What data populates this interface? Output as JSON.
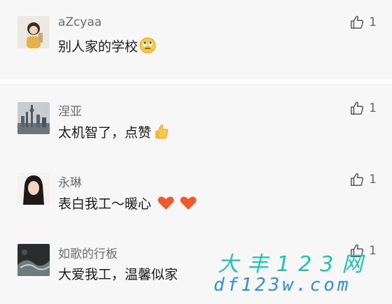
{
  "comments": [
    {
      "name": "aZcyaa",
      "text": "别人家的学校",
      "emoji": "rolling-eyes",
      "likes": "1"
    },
    {
      "name": "涅亚",
      "text": "太机智了，点赞",
      "emoji": "thumbs-up",
      "likes": "1"
    },
    {
      "name": "永琳",
      "text": "表白我工～暖心",
      "emoji": "two-hearts",
      "likes": "1"
    },
    {
      "name": "如歌的行板",
      "text": "大爱我工，温馨似家",
      "emoji": "",
      "likes": "1"
    }
  ],
  "watermark": {
    "line1": "大丰123网",
    "line2": "df123w.com"
  },
  "colors": {
    "background": "#f7f7f7",
    "separator": "#ffffff",
    "name": "#6b6b6b",
    "text": "#1a1a1a",
    "watermark_green": "#19c7b5",
    "watermark_blue": "#2f8ee6"
  }
}
